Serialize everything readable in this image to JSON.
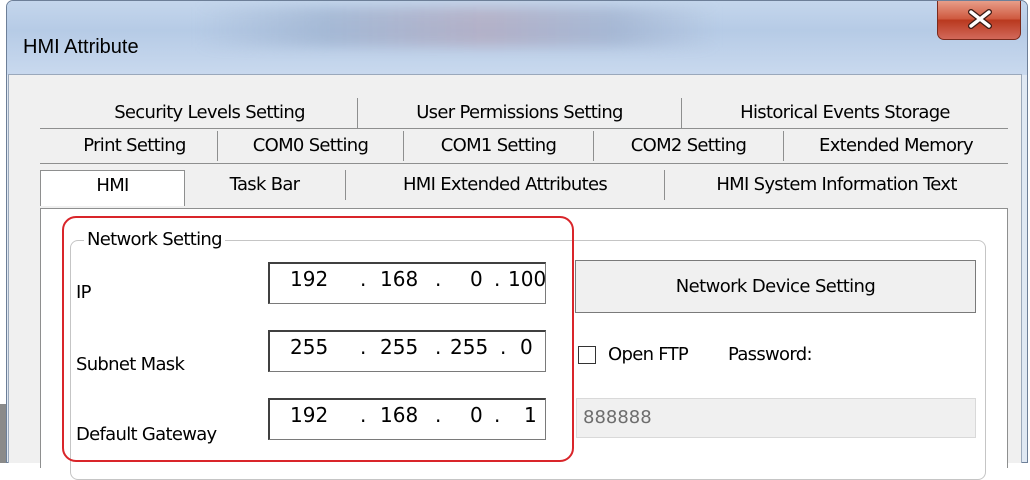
{
  "window": {
    "title": "HMI Attribute"
  },
  "tabs": {
    "row1": [
      "Security Levels Setting",
      "User Permissions Setting",
      "Historical Events Storage"
    ],
    "row2": [
      "Print Setting",
      "COM0 Setting",
      "COM1 Setting",
      "COM2 Setting",
      "Extended Memory"
    ],
    "row3": [
      "HMI",
      "Task Bar",
      "HMI Extended Attributes",
      "HMI System Information Text"
    ],
    "active": "HMI"
  },
  "network": {
    "group_label": "Network Setting",
    "ip": {
      "label": "IP",
      "octets": [
        "192",
        "168",
        "0",
        "100"
      ]
    },
    "subnet": {
      "label": "Subnet Mask",
      "octets": [
        "255",
        "255",
        "255",
        "0"
      ]
    },
    "gateway": {
      "label": "Default Gateway",
      "octets": [
        "192",
        "168",
        "0",
        "1"
      ]
    },
    "device_button": "Network Device Setting",
    "open_ftp_label": "Open FTP",
    "open_ftp_checked": false,
    "password_label": "Password:",
    "password_value": "888888"
  },
  "colors": {
    "highlight": "#d9252a",
    "close_button": "#c8472d"
  }
}
